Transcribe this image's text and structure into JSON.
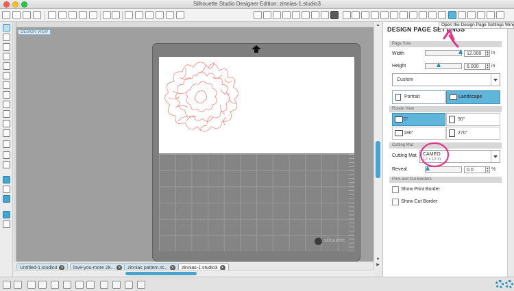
{
  "window": {
    "title": "Silhouette Studio Designer Edition: zinnias-1.studio3"
  },
  "canvas": {
    "badge": "DESIGN VIEW",
    "logo_text": "silhouette"
  },
  "tabs": [
    {
      "label": "Untitled-1.studio3",
      "close": "x"
    },
    {
      "label": "love-you-more 28...",
      "close": "x"
    },
    {
      "label": "zinnias pattern.st...",
      "close": "x"
    },
    {
      "label": "zinnias-1.studio3",
      "close": "x"
    }
  ],
  "tooltip": "Open the Design Page Settings Window",
  "panel": {
    "title": "DESIGN PAGE SETTINGS",
    "page_size": {
      "section": "Page Size",
      "width_label": "Width",
      "width_value": "12.000",
      "width_unit": "in",
      "height_label": "Height",
      "height_value": "6.000",
      "height_unit": "in",
      "preset": "Custom",
      "portrait": "Portrait",
      "landscape": "Landscape"
    },
    "rotate_view": {
      "section": "Rotate View",
      "options": [
        "0°",
        "90°",
        "180°",
        "270°"
      ]
    },
    "cutting_mat": {
      "section": "Cutting Mat",
      "label": "Cutting Mat",
      "name": "CAMEO",
      "size": "12 x 12 in",
      "reveal_label": "Reveal",
      "reveal_value": "0.0",
      "reveal_unit": "%"
    },
    "borders": {
      "section": "Print and Cut Borders",
      "print": "Show Print Border",
      "cut": "Show Cut Border"
    }
  },
  "colors": {
    "accent": "#4aa3cc",
    "flower_stroke": "#f0938c",
    "annotation": "#e0368a"
  },
  "icons": [
    "new-icon",
    "open-icon",
    "save-icon",
    "print-icon",
    "cut-icon",
    "copy-icon",
    "paste-icon",
    "undo-icon",
    "redo-icon",
    "pan-icon",
    "zoom-in-icon",
    "zoom-out-icon",
    "zoom-box-icon",
    "fit-icon",
    "design-page-settings-icon",
    "gear-icon"
  ]
}
